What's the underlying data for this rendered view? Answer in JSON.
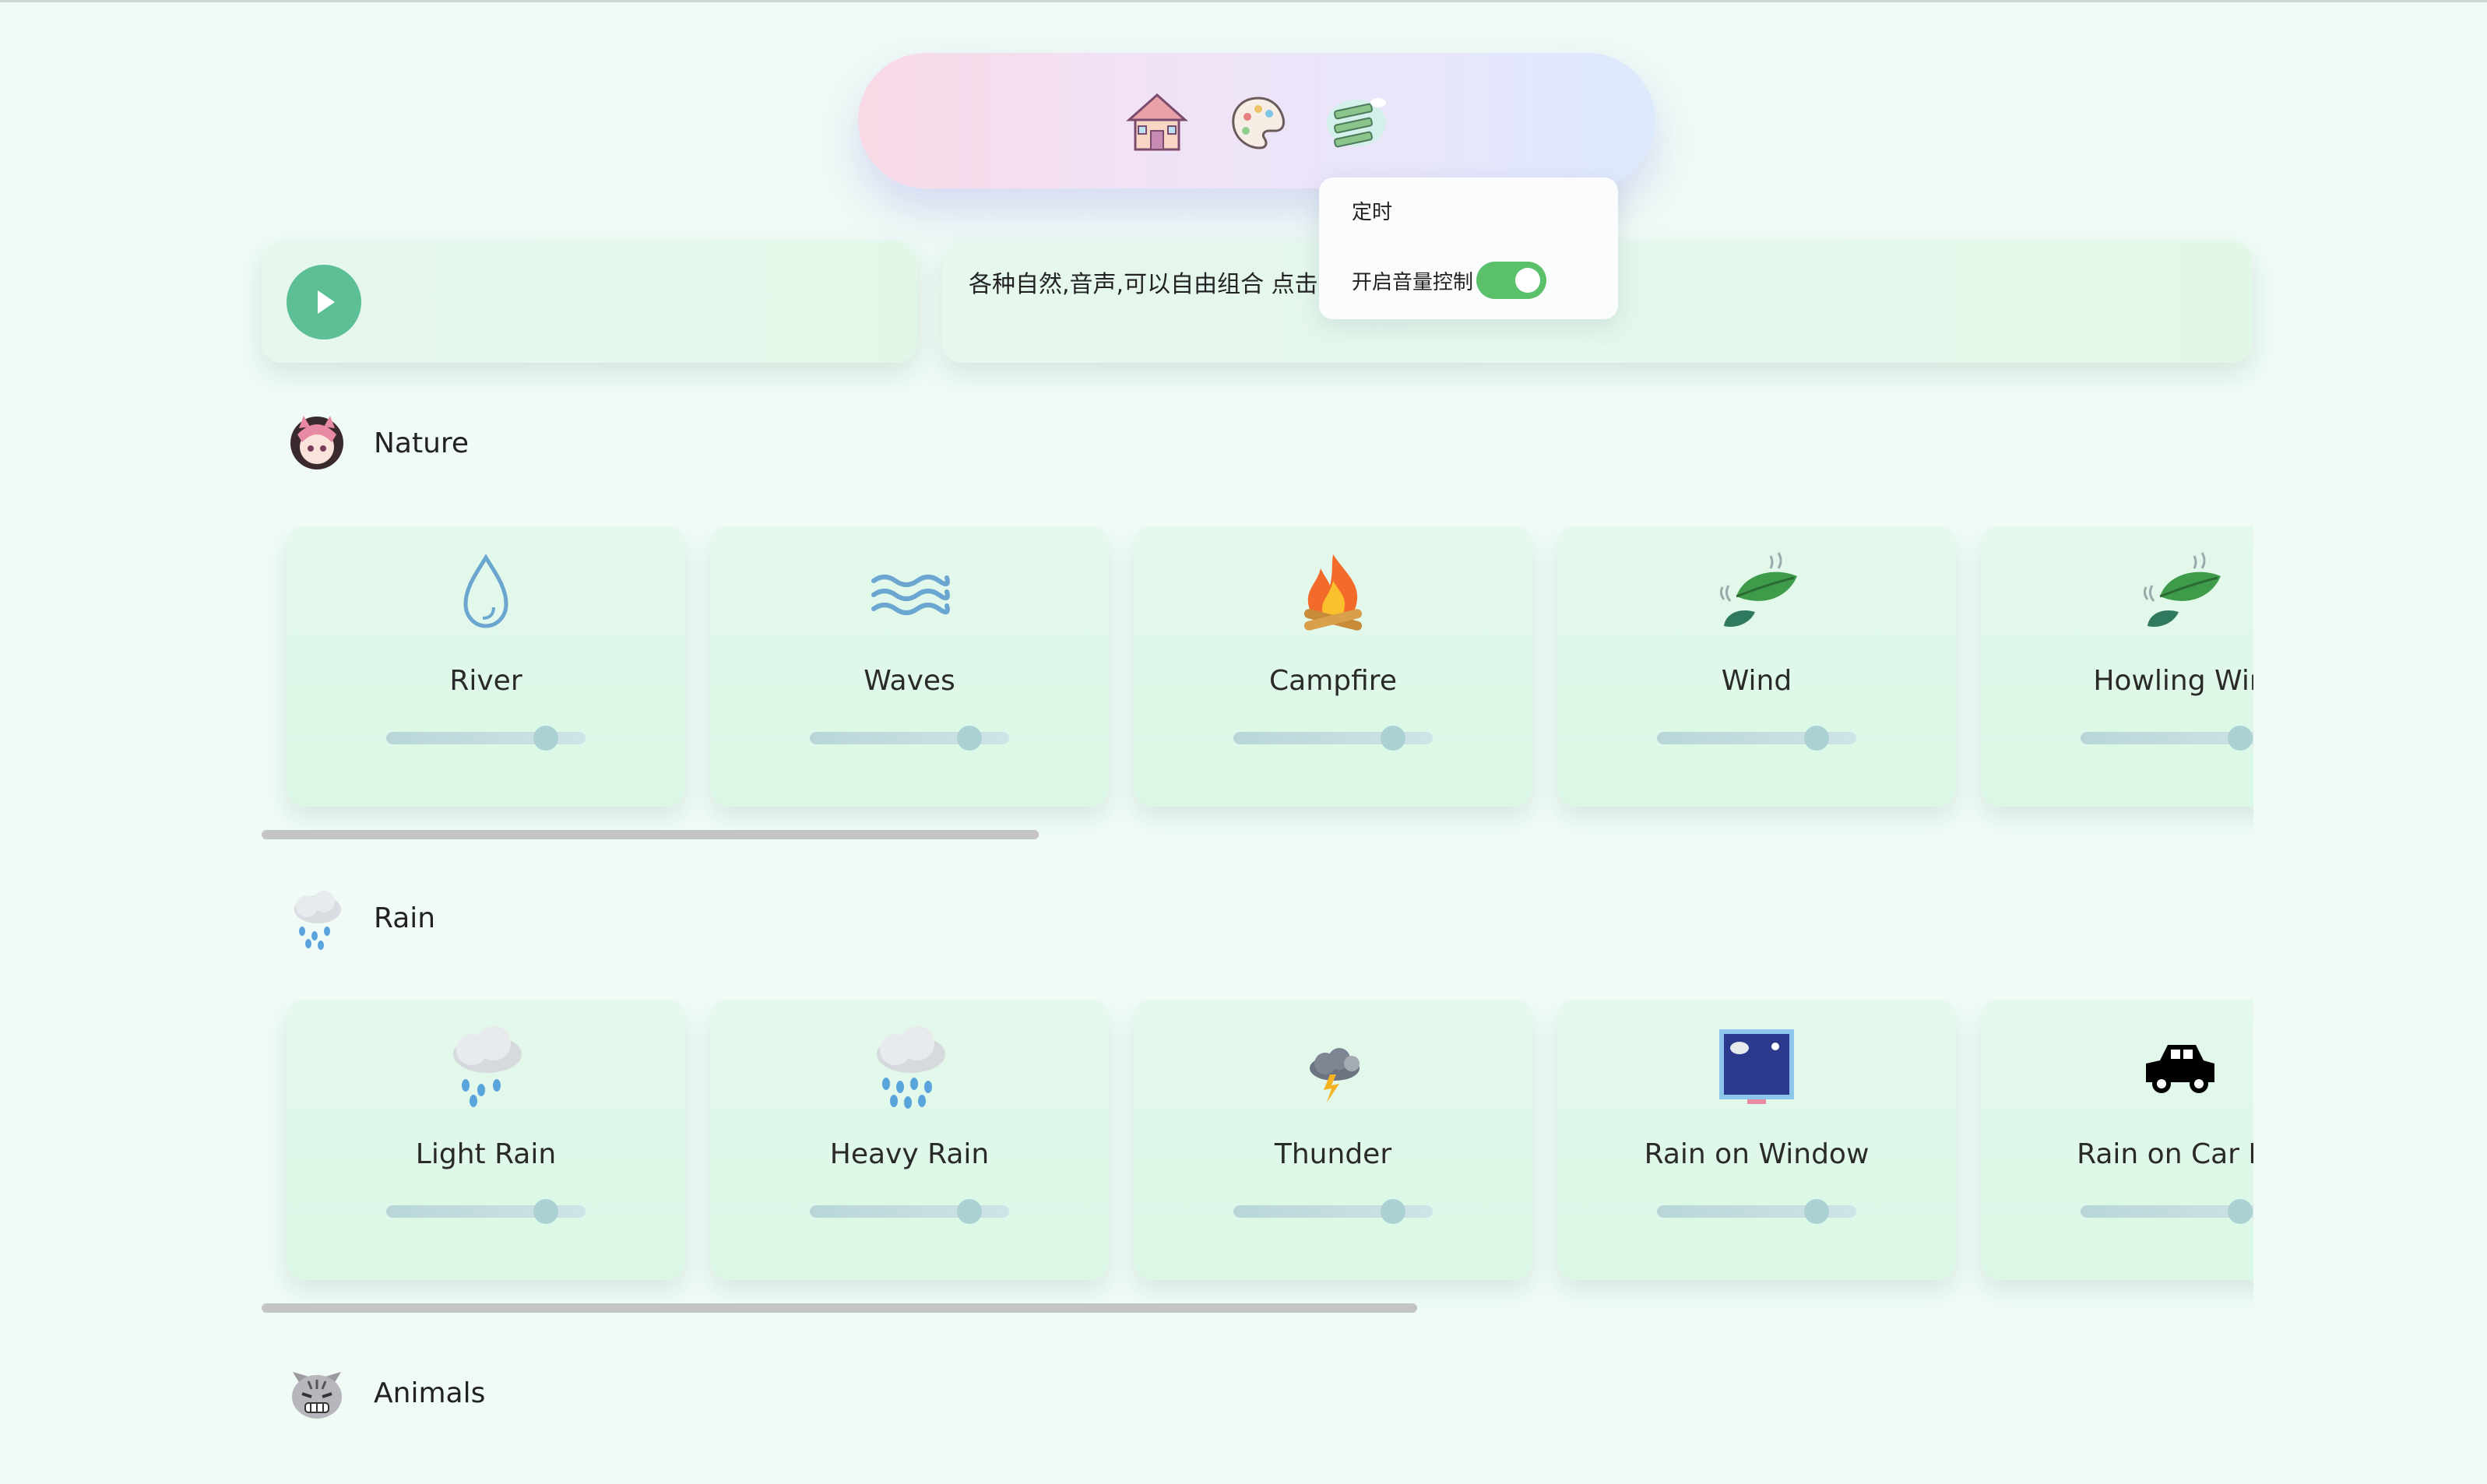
{
  "nav": {
    "items": [
      {
        "name": "home-icon"
      },
      {
        "name": "palette-icon"
      },
      {
        "name": "menu-icon"
      }
    ]
  },
  "popup": {
    "timer_label": "定时",
    "volume_label": "开启音量控制",
    "volume_enabled": true,
    "toggle_color": "#5bc06a"
  },
  "player": {
    "description": "各种自然,音声,可以自由组合 点击"
  },
  "categories": [
    {
      "title": "Nature",
      "icon": "anime-avatar-icon",
      "scroll_fraction": 0.39,
      "cards": [
        {
          "name": "River",
          "icon": "water-drop-icon",
          "volume": 0.8
        },
        {
          "name": "Waves",
          "icon": "waves-icon",
          "volume": 0.8
        },
        {
          "name": "Campfire",
          "icon": "campfire-icon",
          "volume": 0.8
        },
        {
          "name": "Wind",
          "icon": "leaf-wind-icon",
          "volume": 0.8
        },
        {
          "name": "Howling Win",
          "icon": "leaf-wind-icon",
          "volume": 0.8
        }
      ]
    },
    {
      "title": "Rain",
      "icon": "rain-cloud-icon",
      "scroll_fraction": 0.58,
      "cards": [
        {
          "name": "Light Rain",
          "icon": "rain-cloud-icon",
          "volume": 0.8
        },
        {
          "name": "Heavy Rain",
          "icon": "heavy-rain-cloud-icon",
          "volume": 0.8
        },
        {
          "name": "Thunder",
          "icon": "thunder-cloud-icon",
          "volume": 0.8
        },
        {
          "name": "Rain on Window",
          "icon": "window-icon",
          "volume": 0.8
        },
        {
          "name": "Rain on Car Ro",
          "icon": "car-icon",
          "volume": 0.8
        }
      ]
    },
    {
      "title": "Animals",
      "icon": "cat-face-icon"
    }
  ],
  "colors": {
    "accent": "#5cbf95",
    "background": "#f0fbf6"
  }
}
